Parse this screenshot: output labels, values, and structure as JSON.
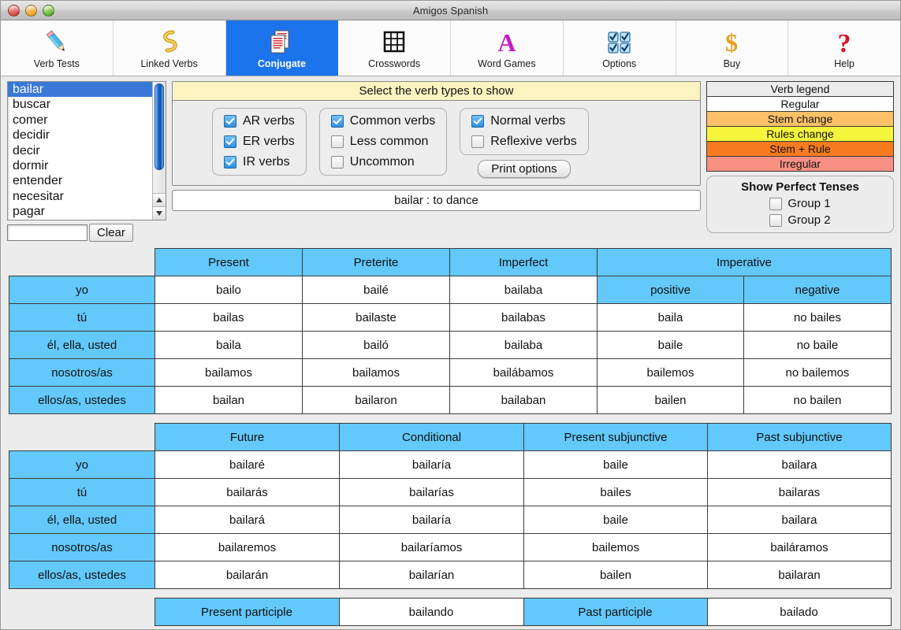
{
  "window": {
    "title": "Amigos Spanish"
  },
  "toolbar": {
    "items": [
      {
        "label": "Verb Tests",
        "icon": "pencil-icon",
        "selected": false
      },
      {
        "label": "Linked Verbs",
        "icon": "chain-link-icon",
        "selected": false
      },
      {
        "label": "Conjugate",
        "icon": "documents-icon",
        "selected": true
      },
      {
        "label": "Crosswords",
        "icon": "grid-icon",
        "selected": false
      },
      {
        "label": "Word Games",
        "icon": "letter-a-icon",
        "selected": false
      },
      {
        "label": "Options",
        "icon": "checkboxes-icon",
        "selected": false
      },
      {
        "label": "Buy",
        "icon": "dollar-icon",
        "selected": false
      },
      {
        "label": "Help",
        "icon": "question-mark-icon",
        "selected": false
      }
    ]
  },
  "verb_list": {
    "items": [
      "bailar",
      "buscar",
      "comer",
      "decidir",
      "decir",
      "dormir",
      "entender",
      "necesitar",
      "pagar"
    ],
    "selected": "bailar",
    "search_value": "",
    "search_placeholder": "",
    "clear_label": "Clear"
  },
  "options_panel": {
    "title": "Select the verb types to show",
    "group_endings": [
      {
        "label": "AR verbs",
        "checked": true
      },
      {
        "label": "ER verbs",
        "checked": true
      },
      {
        "label": "IR verbs",
        "checked": true
      }
    ],
    "group_frequency": [
      {
        "label": "Common verbs",
        "checked": true
      },
      {
        "label": "Less common",
        "checked": false
      },
      {
        "label": "Uncommon",
        "checked": false
      }
    ],
    "group_kind": [
      {
        "label": "Normal verbs",
        "checked": true
      },
      {
        "label": "Reflexive verbs",
        "checked": false
      }
    ],
    "print_options_label": "Print options"
  },
  "verb_definition": "bailar : to dance",
  "legend": {
    "title": "Verb legend",
    "rows": [
      {
        "label": "Regular",
        "color": "#ffffff"
      },
      {
        "label": "Stem change",
        "color": "#fcc168"
      },
      {
        "label": "Rules change",
        "color": "#f5f53c"
      },
      {
        "label": "Stem + Rule",
        "color": "#f77b1e"
      },
      {
        "label": "Irregular",
        "color": "#f79083"
      }
    ]
  },
  "perfect_tenses": {
    "title": "Show Perfect Tenses",
    "options": [
      {
        "label": "Group 1",
        "checked": false
      },
      {
        "label": "Group 2",
        "checked": false
      }
    ]
  },
  "pronouns": [
    "yo",
    "tú",
    "él, ella, usted",
    "nosotros/as",
    "ellos/as, ustedes"
  ],
  "table1": {
    "headers": [
      "Present",
      "Preterite",
      "Imperfect",
      "Imperative"
    ],
    "imperative_sub": [
      "positive",
      "negative"
    ],
    "present": [
      "bailo",
      "bailas",
      "baila",
      "bailamos",
      "bailan"
    ],
    "preterite": [
      "bailé",
      "bailaste",
      "bailó",
      "bailamos",
      "bailaron"
    ],
    "imperfect": [
      "bailaba",
      "bailabas",
      "bailaba",
      "bailábamos",
      "bailaban"
    ],
    "imperative_positive": [
      "baila",
      "baile",
      "bailemos",
      "bailen"
    ],
    "imperative_negative": [
      "no bailes",
      "no baile",
      "no bailemos",
      "no bailen"
    ]
  },
  "table2": {
    "headers": [
      "Future",
      "Conditional",
      "Present subjunctive",
      "Past subjunctive"
    ],
    "future": [
      "bailaré",
      "bailarás",
      "bailará",
      "bailaremos",
      "bailarán"
    ],
    "conditional": [
      "bailaría",
      "bailarías",
      "bailaría",
      "bailaríamos",
      "bailarían"
    ],
    "present_subjunctive": [
      "baile",
      "bailes",
      "baile",
      "bailemos",
      "bailen"
    ],
    "past_subjunctive": [
      "bailara",
      "bailaras",
      "bailara",
      "bailáramos",
      "bailaran"
    ]
  },
  "participles": {
    "present_label": "Present participle",
    "present_value": "bailando",
    "past_label": "Past participle",
    "past_value": "bailado"
  }
}
